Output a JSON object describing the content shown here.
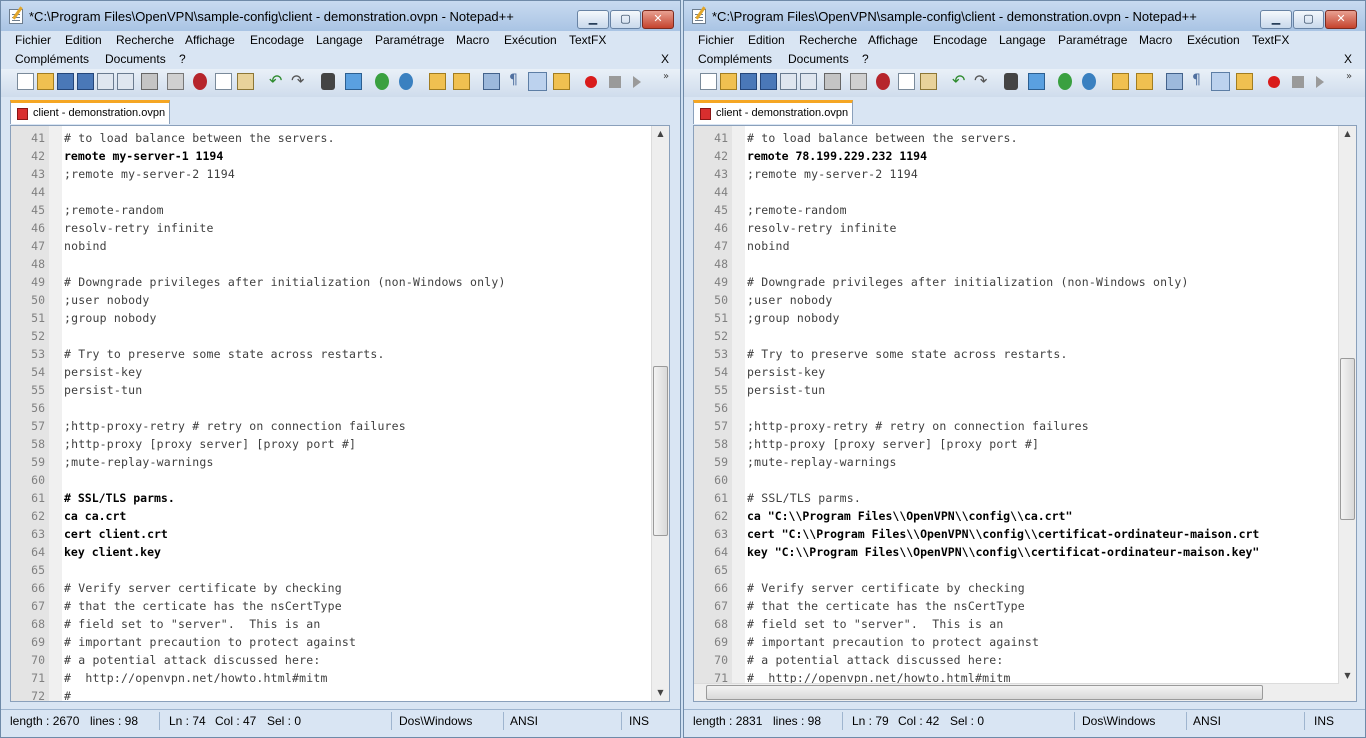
{
  "left": {
    "title": "*C:\\Program Files\\OpenVPN\\sample-config\\client - demonstration.ovpn - Notepad++",
    "menu": [
      "Fichier",
      "Edition",
      "Recherche",
      "Affichage",
      "Encodage",
      "Langage",
      "Paramétrage",
      "Macro",
      "Exécution",
      "TextFX"
    ],
    "menu2": [
      "Compléments",
      "Documents",
      "?"
    ],
    "menu_close": "X",
    "tab": "client - demonstration.ovpn",
    "lines": [
      {
        "n": "41",
        "t": "# to load balance between the servers.",
        "s": "cmt"
      },
      {
        "n": "42",
        "t": "remote my-server-1 1194",
        "s": "bold"
      },
      {
        "n": "43",
        "t": ";remote my-server-2 1194",
        "s": "cmt"
      },
      {
        "n": "44",
        "t": "",
        "s": ""
      },
      {
        "n": "45",
        "t": ";remote-random",
        "s": "cmt"
      },
      {
        "n": "46",
        "t": "resolv-retry infinite",
        "s": "cmt"
      },
      {
        "n": "47",
        "t": "nobind",
        "s": "cmt"
      },
      {
        "n": "48",
        "t": "",
        "s": ""
      },
      {
        "n": "49",
        "t": "# Downgrade privileges after initialization (non-Windows only)",
        "s": "cmt"
      },
      {
        "n": "50",
        "t": ";user nobody",
        "s": "cmt"
      },
      {
        "n": "51",
        "t": ";group nobody",
        "s": "cmt"
      },
      {
        "n": "52",
        "t": "",
        "s": ""
      },
      {
        "n": "53",
        "t": "# Try to preserve some state across restarts.",
        "s": "cmt"
      },
      {
        "n": "54",
        "t": "persist-key",
        "s": "cmt"
      },
      {
        "n": "55",
        "t": "persist-tun",
        "s": "cmt"
      },
      {
        "n": "56",
        "t": "",
        "s": ""
      },
      {
        "n": "57",
        "t": ";http-proxy-retry # retry on connection failures",
        "s": "cmt"
      },
      {
        "n": "58",
        "t": ";http-proxy [proxy server] [proxy port #]",
        "s": "cmt"
      },
      {
        "n": "59",
        "t": ";mute-replay-warnings",
        "s": "cmt"
      },
      {
        "n": "60",
        "t": "",
        "s": ""
      },
      {
        "n": "61",
        "t": "# SSL/TLS parms.",
        "s": "bold"
      },
      {
        "n": "62",
        "t": "ca ca.crt",
        "s": "bold"
      },
      {
        "n": "63",
        "t": "cert client.crt",
        "s": "bold"
      },
      {
        "n": "64",
        "t": "key client.key",
        "s": "bold"
      },
      {
        "n": "65",
        "t": "",
        "s": ""
      },
      {
        "n": "66",
        "t": "# Verify server certificate by checking",
        "s": "cmt"
      },
      {
        "n": "67",
        "t": "# that the certicate has the nsCertType",
        "s": "cmt"
      },
      {
        "n": "68",
        "t": "# field set to \"server\".  This is an",
        "s": "cmt"
      },
      {
        "n": "69",
        "t": "# important precaution to protect against",
        "s": "cmt"
      },
      {
        "n": "70",
        "t": "# a potential attack discussed here:",
        "s": "cmt"
      },
      {
        "n": "71",
        "t": "#  http://openvpn.net/howto.html#mitm",
        "s": "cmt"
      },
      {
        "n": "72",
        "t": "#",
        "s": "cmt"
      }
    ],
    "status": {
      "length": "length : 2670",
      "lines": "lines : 98",
      "ln": "Ln : 74",
      "col": "Col : 47",
      "sel": "Sel : 0",
      "eol": "Dos\\Windows",
      "enc": "ANSI",
      "mode": "INS"
    }
  },
  "right": {
    "title": "*C:\\Program Files\\OpenVPN\\sample-config\\client - demonstration.ovpn - Notepad++",
    "menu": [
      "Fichier",
      "Edition",
      "Recherche",
      "Affichage",
      "Encodage",
      "Langage",
      "Paramétrage",
      "Macro",
      "Exécution",
      "TextFX"
    ],
    "menu2": [
      "Compléments",
      "Documents",
      "?"
    ],
    "menu_close": "X",
    "tab": "client - demonstration.ovpn",
    "lines": [
      {
        "n": "41",
        "t": "# to load balance between the servers.",
        "s": "cmt"
      },
      {
        "n": "42",
        "t": "remote 78.199.229.232 1194",
        "s": "bold"
      },
      {
        "n": "43",
        "t": ";remote my-server-2 1194",
        "s": "cmt"
      },
      {
        "n": "44",
        "t": "",
        "s": ""
      },
      {
        "n": "45",
        "t": ";remote-random",
        "s": "cmt"
      },
      {
        "n": "46",
        "t": "resolv-retry infinite",
        "s": "cmt"
      },
      {
        "n": "47",
        "t": "nobind",
        "s": "cmt"
      },
      {
        "n": "48",
        "t": "",
        "s": ""
      },
      {
        "n": "49",
        "t": "# Downgrade privileges after initialization (non-Windows only)",
        "s": "cmt"
      },
      {
        "n": "50",
        "t": ";user nobody",
        "s": "cmt"
      },
      {
        "n": "51",
        "t": ";group nobody",
        "s": "cmt"
      },
      {
        "n": "52",
        "t": "",
        "s": ""
      },
      {
        "n": "53",
        "t": "# Try to preserve some state across restarts.",
        "s": "cmt"
      },
      {
        "n": "54",
        "t": "persist-key",
        "s": "cmt"
      },
      {
        "n": "55",
        "t": "persist-tun",
        "s": "cmt"
      },
      {
        "n": "56",
        "t": "",
        "s": ""
      },
      {
        "n": "57",
        "t": ";http-proxy-retry # retry on connection failures",
        "s": "cmt"
      },
      {
        "n": "58",
        "t": ";http-proxy [proxy server] [proxy port #]",
        "s": "cmt"
      },
      {
        "n": "59",
        "t": ";mute-replay-warnings",
        "s": "cmt"
      },
      {
        "n": "60",
        "t": "",
        "s": ""
      },
      {
        "n": "61",
        "t": "# SSL/TLS parms.",
        "s": "cmt"
      },
      {
        "n": "62",
        "t": "ca \"C:\\\\Program Files\\\\OpenVPN\\\\config\\\\ca.crt\"",
        "s": "bold"
      },
      {
        "n": "63",
        "t": "cert \"C:\\\\Program Files\\\\OpenVPN\\\\config\\\\certificat-ordinateur-maison.crt",
        "s": "bold"
      },
      {
        "n": "64",
        "t": "key \"C:\\\\Program Files\\\\OpenVPN\\\\config\\\\certificat-ordinateur-maison.key\"",
        "s": "bold"
      },
      {
        "n": "65",
        "t": "",
        "s": ""
      },
      {
        "n": "66",
        "t": "# Verify server certificate by checking",
        "s": "cmt"
      },
      {
        "n": "67",
        "t": "# that the certicate has the nsCertType",
        "s": "cmt"
      },
      {
        "n": "68",
        "t": "# field set to \"server\".  This is an",
        "s": "cmt"
      },
      {
        "n": "69",
        "t": "# important precaution to protect against",
        "s": "cmt"
      },
      {
        "n": "70",
        "t": "# a potential attack discussed here:",
        "s": "cmt"
      },
      {
        "n": "71",
        "t": "#  http://openvpn.net/howto.html#mitm",
        "s": "cmt"
      }
    ],
    "status": {
      "length": "length : 2831",
      "lines": "lines : 98",
      "ln": "Ln : 79",
      "col": "Col : 42",
      "sel": "Sel : 0",
      "eol": "Dos\\Windows",
      "enc": "ANSI",
      "mode": "INS"
    }
  },
  "colors": {
    "accent_tab": "#f5a623",
    "record": "#d91c1c"
  }
}
